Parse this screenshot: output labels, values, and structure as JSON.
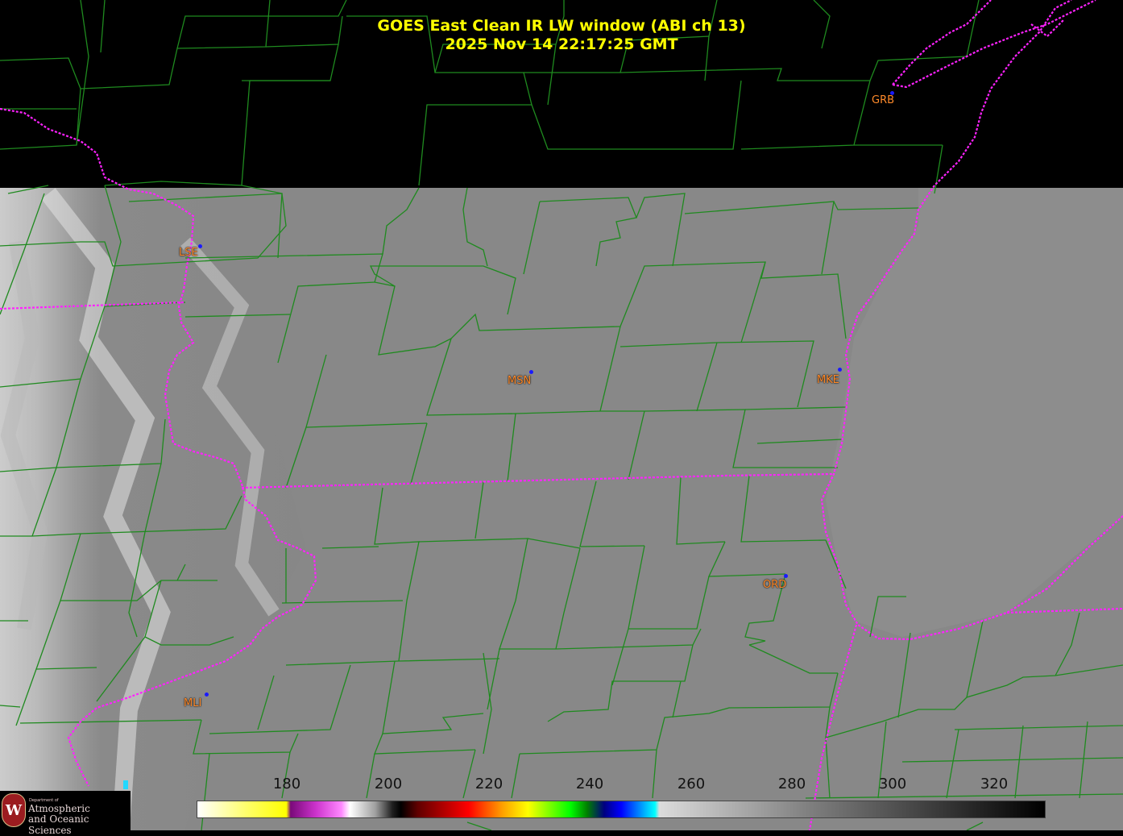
{
  "title_line1": "GOES East Clean IR LW window (ABI ch 13)",
  "title_line2": "2025 Nov 14  22:17:25 GMT",
  "stations": [
    {
      "code": "GRB"
    },
    {
      "code": "LSE"
    },
    {
      "code": "MSN"
    },
    {
      "code": "MKE"
    },
    {
      "code": "ORD"
    },
    {
      "code": "MLI"
    }
  ],
  "colorbar": {
    "unit_ticks": [
      "180",
      "200",
      "220",
      "240",
      "260",
      "280",
      "300",
      "320"
    ],
    "range": [
      163,
      330
    ]
  },
  "logo": {
    "dept_small": "Department of",
    "line1": "Atmospheric",
    "line2": "and Oceanic Sciences",
    "seal_letter": "W"
  },
  "colors": {
    "title": "#ffff00",
    "county_lines": "#1f8a1f",
    "state_lines": "#ff22ff",
    "station_label": "#ff8a2a",
    "station_dot": "#1a1aff"
  }
}
